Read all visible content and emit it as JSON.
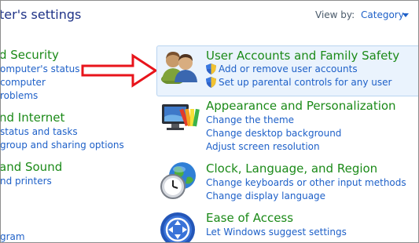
{
  "header": {
    "title": "ter's settings",
    "view_by_label": "View by:",
    "view_by_value": "Category"
  },
  "left_column": {
    "groups": [
      {
        "heading": "d Security",
        "links": [
          "omputer's status",
          "computer",
          "roblems"
        ]
      },
      {
        "heading": "nd Internet",
        "links": [
          "status and tasks",
          "group and sharing options"
        ]
      },
      {
        "heading": "and Sound",
        "links": [
          "nd printers"
        ]
      },
      {
        "heading": "",
        "links": [
          "gram"
        ]
      }
    ]
  },
  "right_column": {
    "categories": [
      {
        "heading": "User Accounts and Family Safety",
        "icon": "users-icon",
        "links": [
          "Add or remove user accounts",
          "Set up parental controls for any user"
        ]
      },
      {
        "heading": "Appearance and Personalization",
        "icon": "monitor-palette-icon",
        "links": [
          "Change the theme",
          "Change desktop background",
          "Adjust screen resolution"
        ]
      },
      {
        "heading": "Clock, Language, and Region",
        "icon": "globe-clock-icon",
        "links": [
          "Change keyboards or other input methods",
          "Change display language"
        ]
      },
      {
        "heading": "Ease of Access",
        "icon": "ease-of-access-icon",
        "links": [
          "Let Windows suggest settings"
        ]
      }
    ]
  },
  "colors": {
    "heading_green": "#1b8a18",
    "link_blue": "#1e60c8",
    "annotation_red": "#e8141b"
  }
}
